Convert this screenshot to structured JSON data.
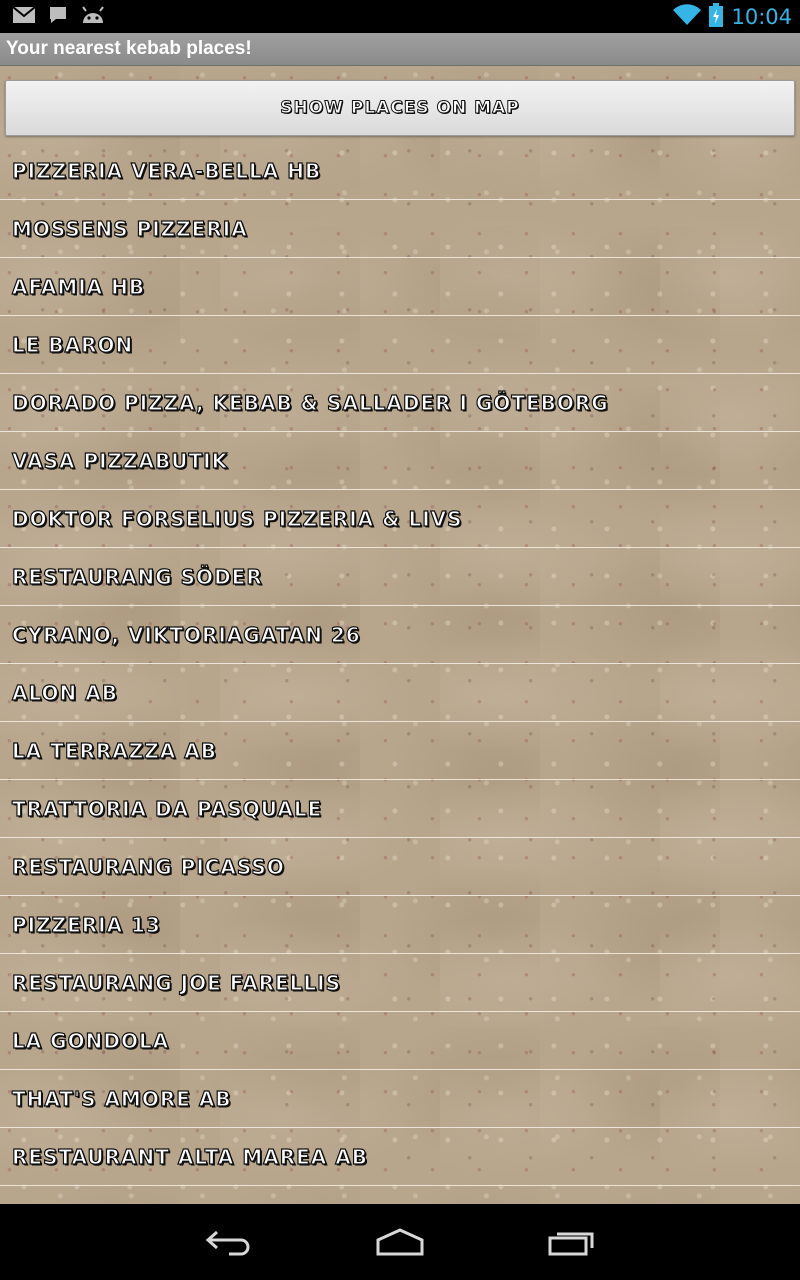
{
  "status_bar": {
    "time": "10:04",
    "left_icons": [
      "gmail-icon",
      "chat-icon",
      "android-icon"
    ],
    "right_icons": [
      "wifi-icon",
      "battery-charging-icon"
    ],
    "accent_color": "#33b5e5"
  },
  "app": {
    "title": "Your nearest kebab places!"
  },
  "main": {
    "map_button_label": "Show places on map",
    "places": [
      "PIZZERIA VERA-BELLA HB",
      "MOSSENS PIZZERIA",
      "AFAMIA HB",
      "LE BARON",
      "DORADO PIZZA, KEBAB & SALLADER I GÖTEBORG",
      "VASA PIZZABUTIK",
      "DOKTOR FORSELIUS PIZZERIA & LIVS",
      "RESTAURANG SÖDER",
      "CYRANO, VIKTORIAGATAN 26",
      "ALON AB",
      "LA TERRAZZA AB",
      "TRATTORIA DA PASQUALE",
      "RESTAURANG PICASSO",
      "PIZZERIA 13",
      "RESTAURANG JOE FARELLIS",
      "LA GONDOLA",
      "THAT'S AMORE AB",
      "RESTAURANT ALTA MAREA AB"
    ]
  },
  "nav_bar": {
    "buttons": [
      "back-icon",
      "home-icon",
      "recents-icon"
    ]
  }
}
